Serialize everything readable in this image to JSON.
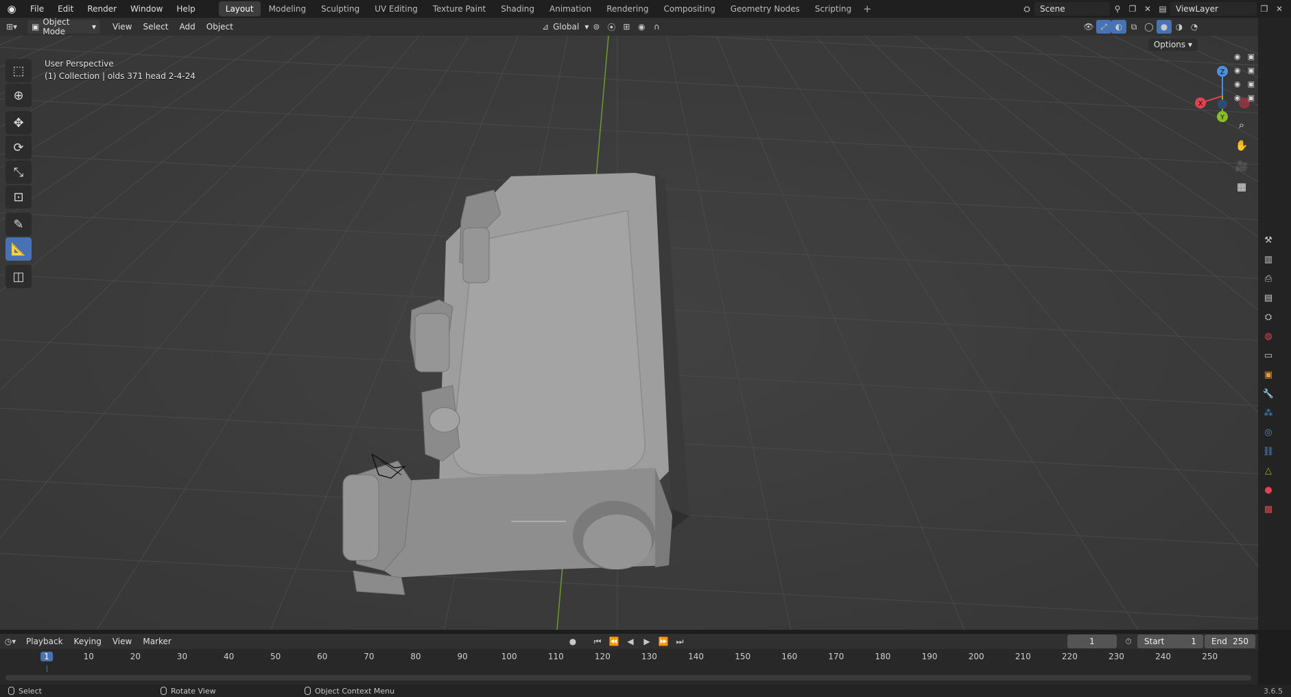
{
  "menus": [
    "File",
    "Edit",
    "Render",
    "Window",
    "Help"
  ],
  "workspaces": [
    "Layout",
    "Modeling",
    "Sculpting",
    "UV Editing",
    "Texture Paint",
    "Shading",
    "Animation",
    "Rendering",
    "Compositing",
    "Geometry Nodes",
    "Scripting"
  ],
  "active_workspace": "Layout",
  "scene": {
    "name": "Scene"
  },
  "view_layer": {
    "name": "ViewLayer"
  },
  "header": {
    "mode": "Object Mode",
    "menus": [
      "View",
      "Select",
      "Add",
      "Object"
    ],
    "transform_orientation": "Global"
  },
  "viewport": {
    "perspective_label": "User Perspective",
    "collection_label": "(1) Collection | olds 371 head 2-4-24",
    "options_label": "Options",
    "gizmo": {
      "x": "X",
      "y": "Y",
      "z": "Z"
    }
  },
  "timeline": {
    "menus": [
      "Playback",
      "Keying",
      "View",
      "Marker"
    ],
    "current_frame": "1",
    "start_label": "Start",
    "start": "1",
    "end_label": "End",
    "end": "250",
    "ticks": [
      "1",
      "10",
      "20",
      "30",
      "40",
      "50",
      "60",
      "70",
      "80",
      "90",
      "100",
      "110",
      "120",
      "130",
      "140",
      "150",
      "160",
      "170",
      "180",
      "190",
      "200",
      "210",
      "220",
      "230",
      "240",
      "250"
    ]
  },
  "status": {
    "left": "Select",
    "middle": "Rotate View",
    "right": "Object Context Menu",
    "version": "3.6.5"
  },
  "colors": {
    "accent": "#4772b3",
    "x_axis": "#e0434f",
    "y_axis": "#8bbd28",
    "z_axis": "#4a8fe0",
    "mesh": "#9a9a9a"
  },
  "icons": {
    "logo": "blender-logo-icon",
    "tools": [
      "select-box-icon",
      "cursor-icon",
      "move-icon",
      "rotate-icon",
      "scale-icon",
      "transform-icon",
      "annotate-icon",
      "measure-icon",
      "add-cube-icon"
    ],
    "nav": [
      "zoom-icon",
      "pan-hand-icon",
      "camera-icon",
      "grid-icon"
    ],
    "props": [
      "tool-icon",
      "render-icon",
      "output-icon",
      "view-layer-icon",
      "scene-icon",
      "world-icon",
      "collection-icon",
      "object-icon",
      "modifier-icon",
      "particles-icon",
      "physics-icon",
      "constraints-icon",
      "data-icon",
      "material-icon",
      "texture-icon"
    ]
  }
}
